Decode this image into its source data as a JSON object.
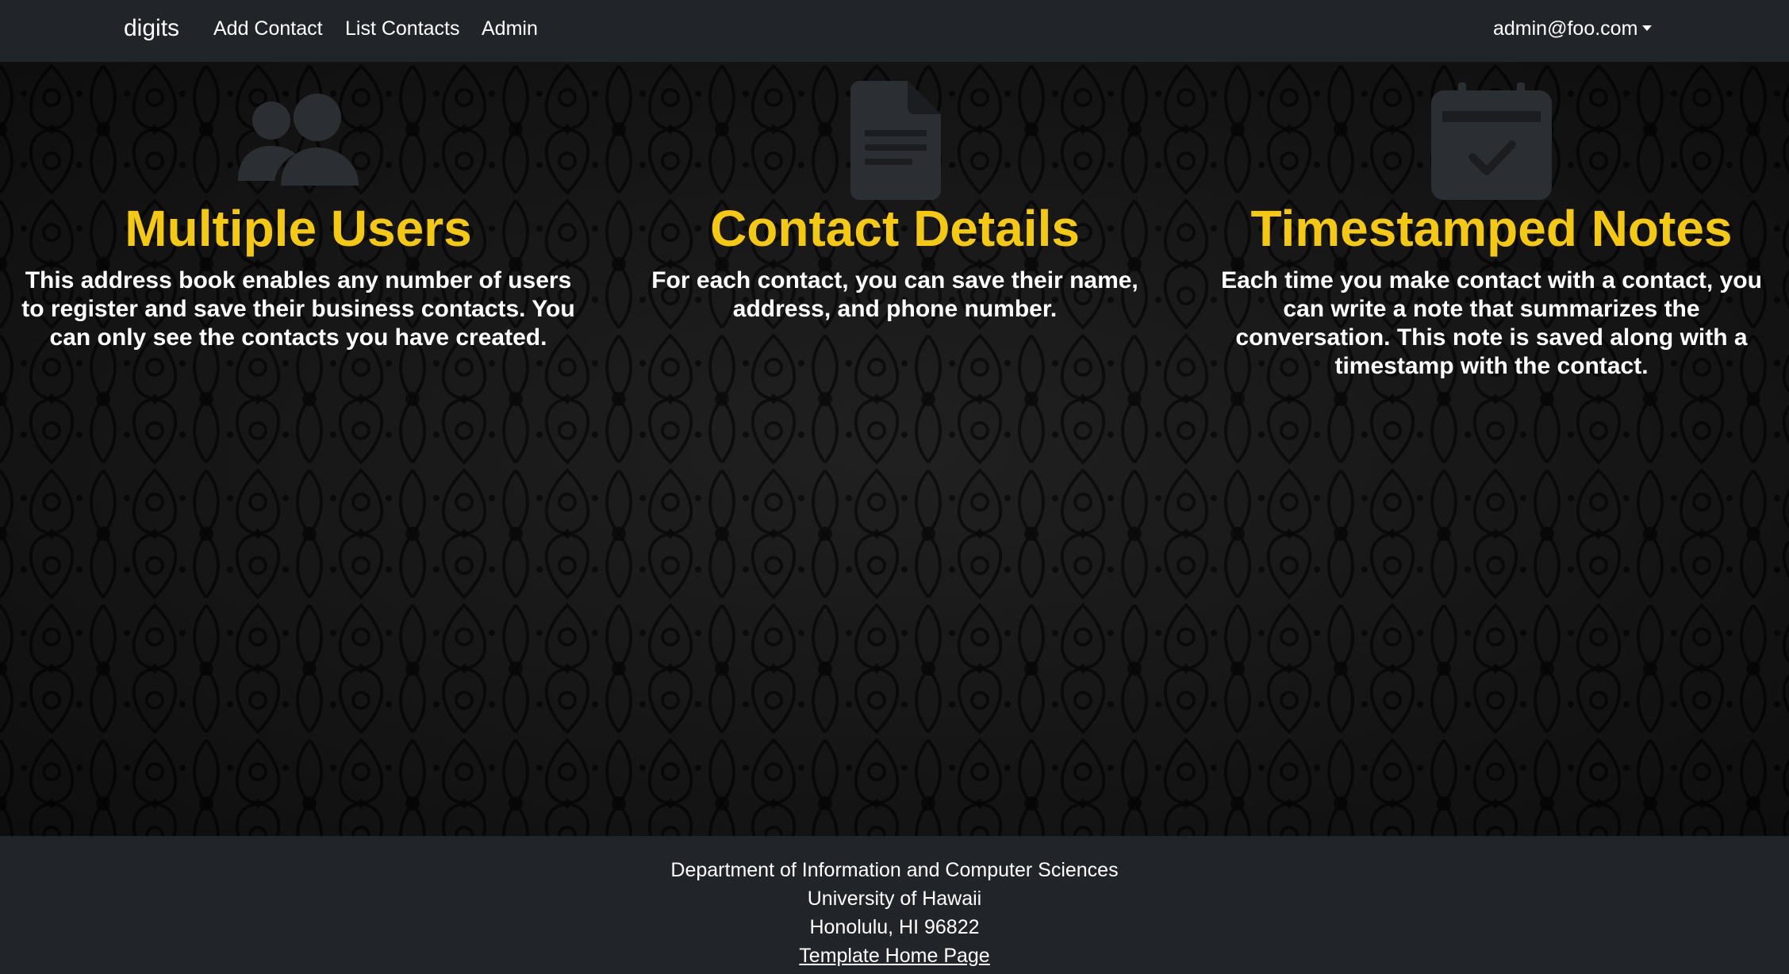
{
  "navbar": {
    "brand": "digits",
    "links": [
      {
        "label": "Add Contact"
      },
      {
        "label": "List Contacts"
      },
      {
        "label": "Admin"
      }
    ],
    "user": "admin@foo.com"
  },
  "features": [
    {
      "icon": "users-icon",
      "title": "Multiple Users",
      "text": "This address book enables any number of users to register and save their business contacts. You can only see the contacts you have created."
    },
    {
      "icon": "file-document-icon",
      "title": "Contact Details",
      "text": "For each contact, you can save their name, address, and phone number."
    },
    {
      "icon": "calendar-check-icon",
      "title": "Timestamped Notes",
      "text": "Each time you make contact with a contact, you can write a note that summarizes the conversation. This note is saved along with a timestamp with the contact."
    }
  ],
  "footer": {
    "line1": "Department of Information and Computer Sciences",
    "line2": "University of Hawaii",
    "line3": "Honolulu, HI 96822",
    "link_label": "Template Home Page"
  },
  "colors": {
    "navbar_bg": "#212529",
    "accent_yellow": "#f6c911",
    "icon_gray": "#2b2e33"
  }
}
